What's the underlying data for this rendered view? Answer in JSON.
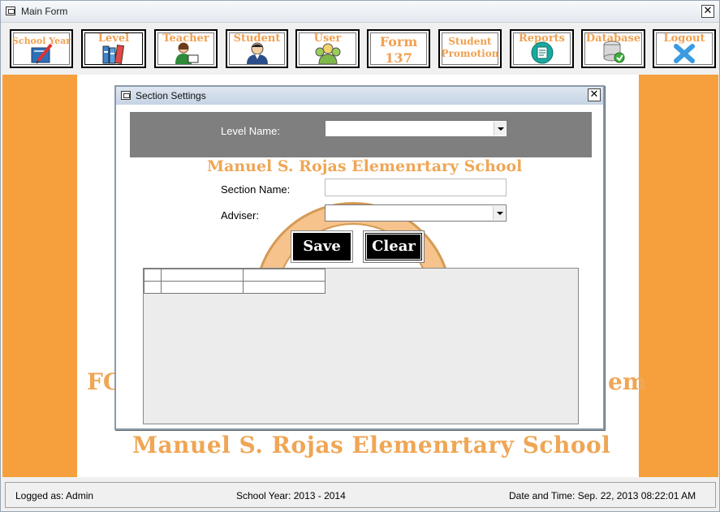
{
  "window": {
    "title": "Main Form",
    "close_icon": "close-icon"
  },
  "toolbar": {
    "items": [
      {
        "label": "School Year",
        "icon": "book-pencil-icon"
      },
      {
        "label": "Level",
        "icon": "books-icon"
      },
      {
        "label": "Teacher",
        "icon": "teacher-icon"
      },
      {
        "label": "Student",
        "icon": "student-icon"
      },
      {
        "label": "User",
        "icon": "users-icon"
      },
      {
        "label_line1": "Form",
        "label_line2": "137",
        "icon": ""
      },
      {
        "label_line1": "Student",
        "label_line2": "Promotion",
        "icon": ""
      },
      {
        "label": "Reports",
        "icon": "report-icon"
      },
      {
        "label": "Database",
        "icon": "database-icon"
      },
      {
        "label": "Logout",
        "icon": "logout-x-icon"
      }
    ]
  },
  "background": {
    "fo_text": "FO",
    "em_text": "em",
    "school_name": "Manuel S. Rojas Elemenrtary School"
  },
  "dialog": {
    "title": "Section Settings",
    "level_name_label": "Level Name:",
    "level_name_value": "",
    "school_name": "Manuel S. Rojas Elemenrtary School",
    "section_name_label": "Section Name:",
    "section_name_value": "",
    "adviser_label": "Adviser:",
    "adviser_value": "",
    "save_label": "Save",
    "clear_label": "Clear",
    "grid": {
      "columns": [
        "",
        ""
      ],
      "rows": [
        [
          "",
          ""
        ]
      ]
    }
  },
  "status": {
    "logged_as": "Logged as: Admin",
    "school_year": "School Year: 2013 - 2014",
    "datetime": "Date and Time: Sep. 22, 2013 08:22:01 AM"
  },
  "colors": {
    "accent_orange": "#f5a03c",
    "title_orange": "#efa655",
    "band_gray": "#7f7f7f"
  }
}
